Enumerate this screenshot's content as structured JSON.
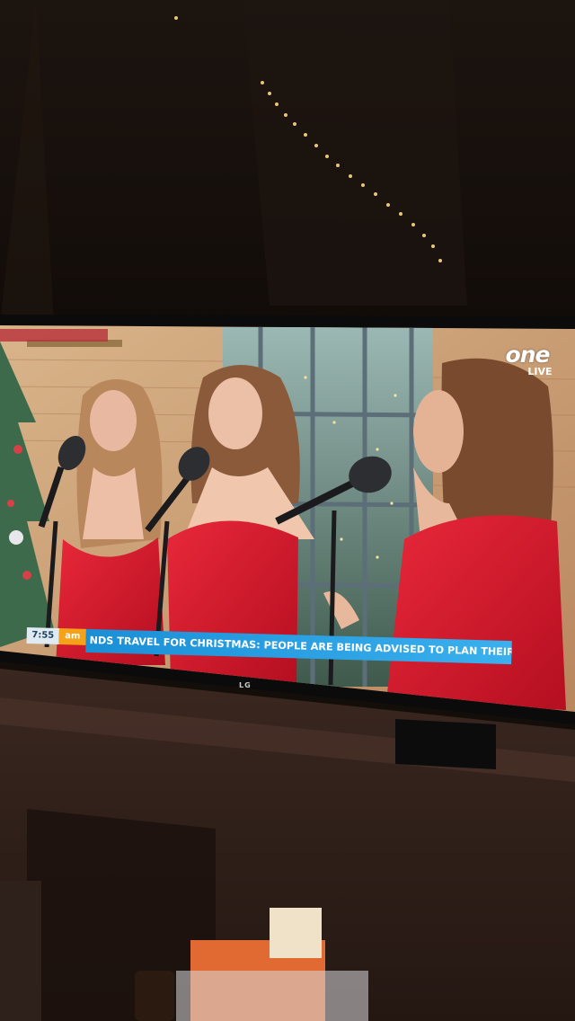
{
  "broadcast": {
    "channel_logo": "one",
    "channel_live": "LIVE",
    "ticker_time": "7:55",
    "programme_badge": "am",
    "ticker_text": "NDS TRAVEL FOR CHRISTMAS: PEOPLE ARE BEING ADVISED TO PLAN THEIR JOURNEYS IN ADVAN"
  },
  "tv_brand": "LG",
  "colors": {
    "dress_red": "#d3172a",
    "ticker_blue": "#2aa2e6",
    "badge_orange": "#f3a21a"
  }
}
